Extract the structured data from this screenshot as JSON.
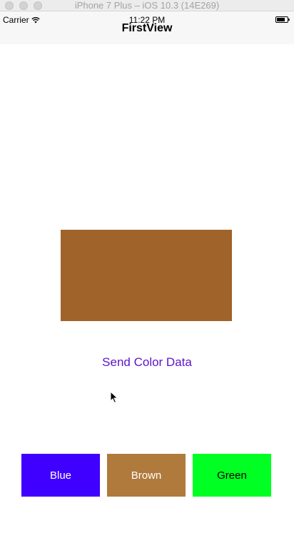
{
  "window": {
    "title": "iPhone 7 Plus – iOS 10.3 (14E269)"
  },
  "status_bar": {
    "carrier": "Carrier",
    "time": "11:22 PM",
    "wifi_icon": "wifi-icon",
    "battery_icon": "battery-icon"
  },
  "nav": {
    "title": "FirstView"
  },
  "preview": {
    "color": "#A0632A"
  },
  "send_button": {
    "label": "Send Color Data",
    "color": "#5B13C8"
  },
  "color_buttons": [
    {
      "label": "Blue",
      "background": "#3F00FF",
      "text_color": "#ffffff"
    },
    {
      "label": "Brown",
      "background": "#B07A3C",
      "text_color": "#ffffff"
    },
    {
      "label": "Green",
      "background": "#00FF22",
      "text_color": "#000000"
    }
  ]
}
